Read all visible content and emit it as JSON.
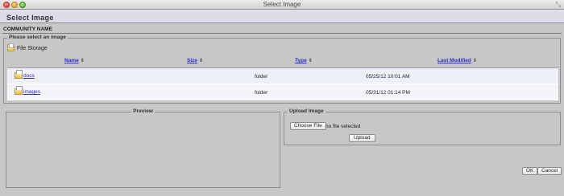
{
  "window": {
    "title": "Select Image",
    "resize_icon": "resize-icon"
  },
  "dialog": {
    "title": "Select Image",
    "community_name": "COMMUNITY NAME"
  },
  "select_section": {
    "legend": "Please select an image",
    "location_label": "File Storage",
    "columns": [
      {
        "label": "Name",
        "sort_icon": "sort-icon"
      },
      {
        "label": "Size",
        "sort_icon": "sort-icon"
      },
      {
        "label": "Type",
        "sort_icon": "sort-icon"
      },
      {
        "label": "Last Modified",
        "sort_icon": "sort-icon"
      }
    ],
    "rows": [
      {
        "name": "docs",
        "size": "",
        "type": "folder",
        "modified": "05/25/12 10:01 AM",
        "icon": "folder-icon"
      },
      {
        "name": "images",
        "size": "",
        "type": "folder",
        "modified": "05/31/12 01:14 PM",
        "icon": "folder-icon"
      }
    ]
  },
  "preview_section": {
    "legend": "Preview"
  },
  "upload_section": {
    "legend": "Upload Image",
    "choose_label": "Choose File",
    "no_file_text": "no file selected",
    "upload_label": "Upload"
  },
  "footer": {
    "ok_label": "OK",
    "cancel_label": "Cancel"
  }
}
